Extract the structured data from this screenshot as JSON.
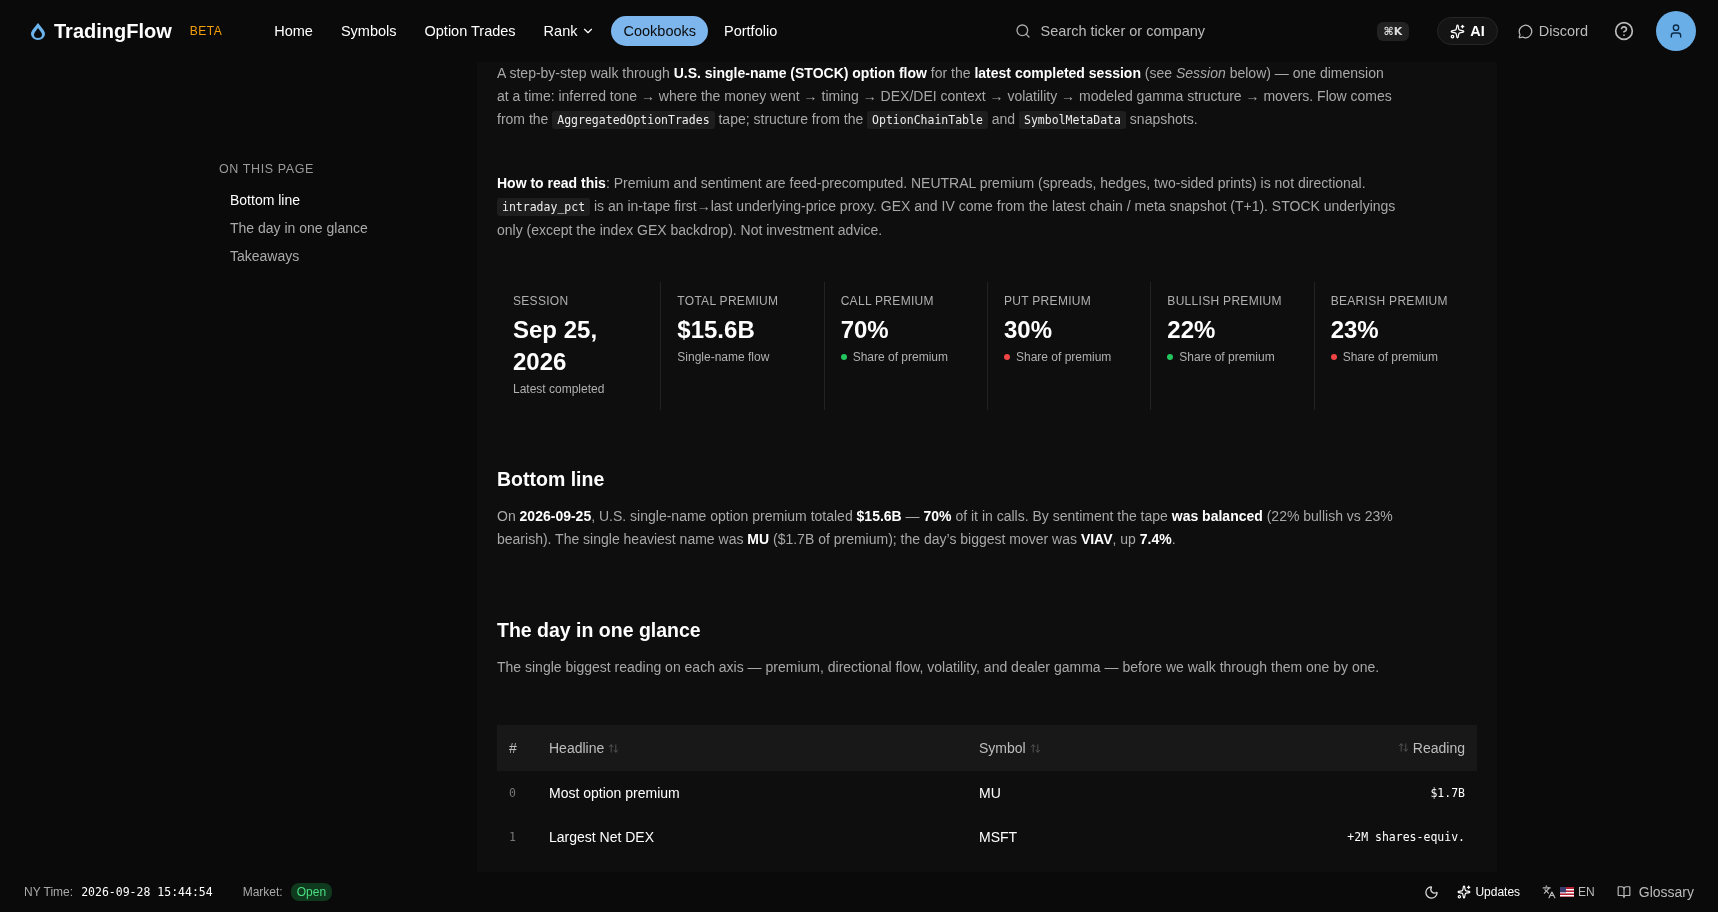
{
  "nav": {
    "brand": "TradingFlow",
    "badge": "BETA",
    "links": [
      {
        "label": "Home",
        "selected": false,
        "dropdown": false
      },
      {
        "label": "Symbols",
        "selected": false,
        "dropdown": false
      },
      {
        "label": "Option Trades",
        "selected": false,
        "dropdown": false
      },
      {
        "label": "Rank",
        "selected": false,
        "dropdown": true
      },
      {
        "label": "Cookbooks",
        "selected": true,
        "dropdown": false
      },
      {
        "label": "Portfolio",
        "selected": false,
        "dropdown": false
      }
    ],
    "search": {
      "placeholder": "Search ticker or company",
      "shortcut": "⌘K"
    },
    "ai": "AI",
    "discord": "Discord"
  },
  "toc": {
    "title": "ON THIS PAGE",
    "items": [
      {
        "label": "Bottom line",
        "selected": true
      },
      {
        "label": "The day in one glance",
        "selected": false
      },
      {
        "label": "Takeaways",
        "selected": false
      }
    ]
  },
  "intro": [
    [
      {
        "t": "A step-by-step walk through **U.S. single-name (STOCK) option flow** for the **latest completed session** (see *Session* below) — one dimension at a time: inferred tone → where the money went → timing → DEX/DEI context → volatility → modeled gamma structure → movers. Flow comes from the "
      },
      {
        "code": "AggregatedOptionTrades"
      },
      {
        "t": " tape; structure from the "
      },
      {
        "code": "OptionChainTable"
      },
      {
        "t": " and "
      },
      {
        "code": "SymbolMetaData"
      },
      {
        "t": " snapshots."
      }
    ],
    [
      {
        "t": "**How to read this**: Premium and sentiment are feed-precomputed. NEUTRAL premium (spreads, hedges, two-sided prints) is not directional. "
      },
      {
        "code": "intraday_pct"
      },
      {
        "t": " is an in-tape first→last underlying-price proxy. GEX and IV come from the latest chain / meta snapshot (T+1). STOCK underlyings only (except the index GEX backdrop). Not investment advice."
      }
    ]
  ],
  "stats": [
    {
      "label": "SESSION",
      "value": "Sep 25, 2026",
      "note": "Latest completed"
    },
    {
      "label": "TOTAL PREMIUM",
      "value": "$15.6B",
      "note": "Single-name flow"
    },
    {
      "label": "CALL PREMIUM",
      "value": "70%",
      "note": "Share of premium",
      "color": "#22c55e"
    },
    {
      "label": "PUT PREMIUM",
      "value": "30%",
      "note": "Share of premium",
      "color": "#ef4444"
    },
    {
      "label": "BULLISH PREMIUM",
      "value": "22%",
      "note": "Share of premium",
      "color": "#22c55e"
    },
    {
      "label": "BEARISH PREMIUM",
      "value": "23%",
      "note": "Share of premium",
      "color": "#ef4444"
    }
  ],
  "sections": [
    {
      "title": "Bottom line",
      "text": "On **2026-09-25**, U.S. single-name option premium totaled **$15.6B** — **70%** of it in calls. By sentiment the tape **was balanced** (22% bullish vs 23% bearish). The single heaviest name was **MU** ($1.7B of premium); the day’s biggest mover was **VIAV**, up **7.4%**."
    },
    {
      "title": "The day in one glance",
      "text": "The single biggest reading on each axis — premium, directional flow, volatility, and dealer gamma — before we walk through them one by one."
    }
  ],
  "table": {
    "columns": [
      {
        "label": "#",
        "sortable": false
      },
      {
        "label": "Headline",
        "sortable": true
      },
      {
        "label": "Symbol",
        "sortable": true
      },
      {
        "label": "Reading",
        "sortable": true
      }
    ],
    "rows": [
      [
        "0",
        "Most option premium",
        "MU",
        "$1.7B"
      ],
      [
        "1",
        "Largest Net DEX",
        "MSFT",
        "+2M shares-equiv."
      ]
    ]
  },
  "footer": {
    "time_label": "NY Time:",
    "time": "2026-09-28 15:44:54",
    "market_label": "Market:",
    "market": "Open",
    "updates": "Updates",
    "lang": "EN",
    "glossary": "Glossary"
  }
}
